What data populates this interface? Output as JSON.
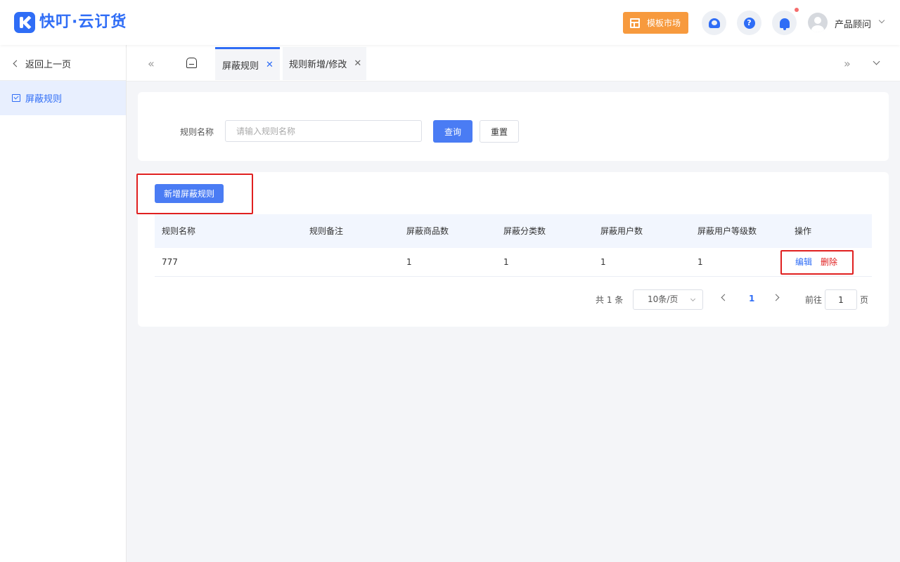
{
  "app": {
    "logo_text": "快叮·云订货",
    "market_label": "模板市场",
    "user_name": "产品顾问"
  },
  "sidebar": {
    "back_label": "返回上一页",
    "items": [
      {
        "label": "屏蔽规则",
        "active": true
      }
    ]
  },
  "tabs": [
    {
      "label": "屏蔽规则",
      "active": true
    },
    {
      "label": "规则新增/修改",
      "active": false
    }
  ],
  "search": {
    "label": "规则名称",
    "placeholder": "请输入规则名称",
    "query_label": "查询",
    "reset_label": "重置"
  },
  "list": {
    "add_label": "新增屏蔽规则",
    "columns": [
      "规则名称",
      "规则备注",
      "屏蔽商品数",
      "屏蔽分类数",
      "屏蔽用户数",
      "屏蔽用户等级数",
      "操作"
    ],
    "rows": [
      {
        "name": "777",
        "remark": "",
        "goods": "1",
        "categories": "1",
        "users": "1",
        "user_levels": "1",
        "edit": "编辑",
        "delete": "删除"
      }
    ]
  },
  "pagination": {
    "total": "共 1 条",
    "page_size": "10条/页",
    "current": "1",
    "goto_label": "前往",
    "goto_value": "1",
    "goto_unit": "页"
  },
  "colors": {
    "primary": "#2f6df6",
    "market": "#f79a3e",
    "danger": "#e02020",
    "highlight": "#e02020"
  }
}
